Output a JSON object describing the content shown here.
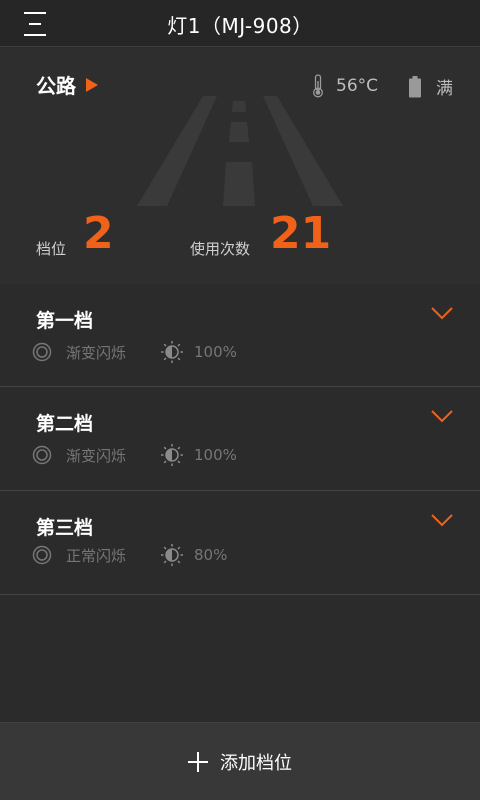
{
  "header": {
    "title": "灯1（MJ-908）"
  },
  "status": {
    "mode": "公路",
    "temperature": "56°C",
    "battery": "满",
    "gear_label": "档位",
    "gear_value": "2",
    "count_label": "使用次数",
    "count_value": "21"
  },
  "gears": [
    {
      "title": "第一档",
      "flash": "渐变闪烁",
      "brightness": "100%"
    },
    {
      "title": "第二档",
      "flash": "渐变闪烁",
      "brightness": "100%"
    },
    {
      "title": "第三档",
      "flash": "正常闪烁",
      "brightness": "80%"
    }
  ],
  "bottom": {
    "add_label": "添加档位"
  },
  "colors": {
    "accent": "#f0621a",
    "background": "#2b2b2b"
  }
}
